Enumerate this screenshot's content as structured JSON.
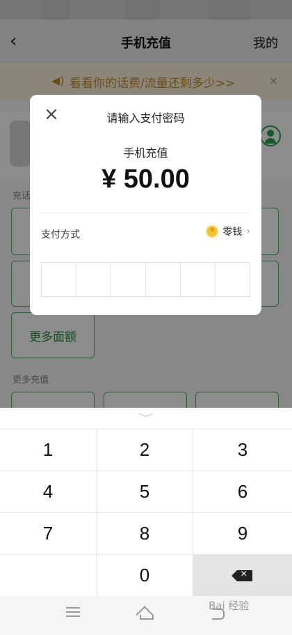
{
  "header": {
    "back_icon": "chevron-left-icon",
    "title": "手机充值",
    "mine": "我的"
  },
  "notice": {
    "icon": "speaker-icon",
    "text": "看看你的话费/流量还剩多少>>",
    "close": "×"
  },
  "sections": {
    "recharge_label": "充话",
    "more_amount": "更多面额",
    "more_recharge_label": "更多充值"
  },
  "dialog": {
    "close_icon": "close-icon",
    "title": "请输入支付密码",
    "product": "手机充值",
    "amount": "¥ 50.00",
    "payment_label": "支付方式",
    "payment_value": "零钱",
    "payment_chevron": "›",
    "password_cells": 6
  },
  "keypad": {
    "collapse_icon": "chevron-down-icon",
    "keys": [
      "1",
      "2",
      "3",
      "4",
      "5",
      "6",
      "7",
      "8",
      "9",
      "",
      "0",
      "delete"
    ]
  },
  "navbar": {
    "items": [
      "menu-icon",
      "home-icon",
      "back-icon"
    ]
  },
  "watermark": "Bai 经验"
}
